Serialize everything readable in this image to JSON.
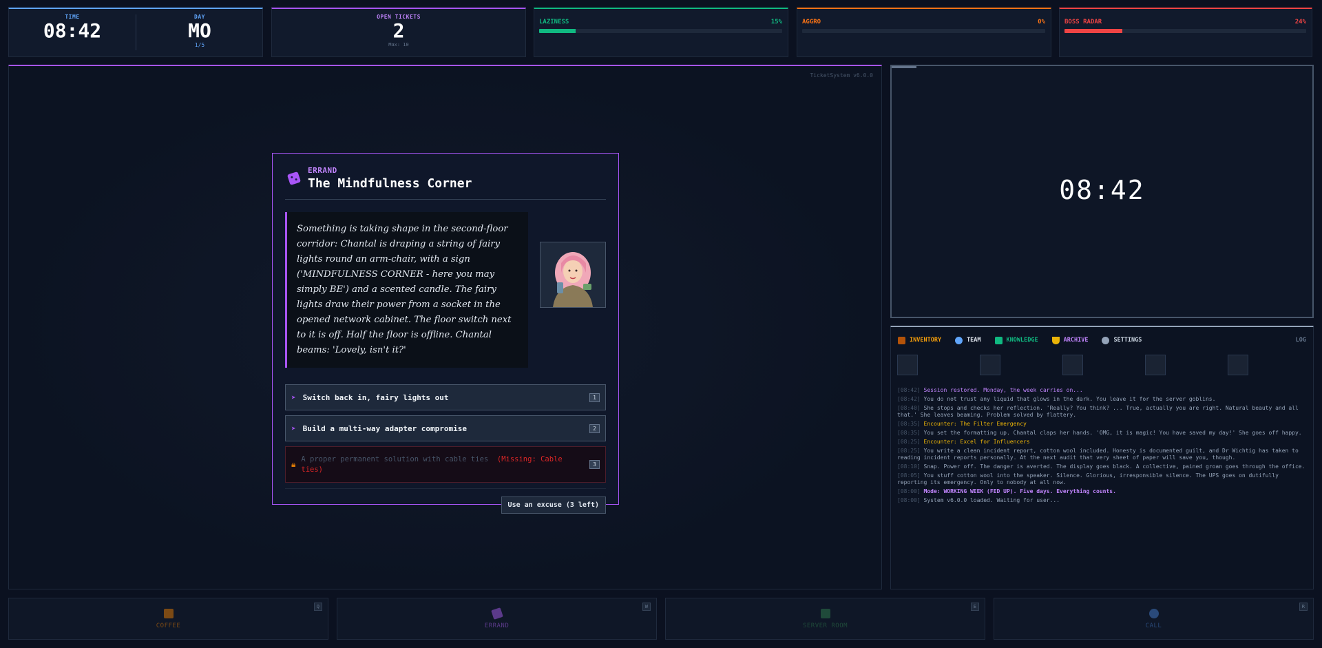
{
  "stats": {
    "time_label": "TIME",
    "time_value": "08:42",
    "day_label": "DAY",
    "day_value": "MO",
    "day_progress": "1/5",
    "tickets_label": "OPEN TICKETS",
    "tickets_value": "2",
    "tickets_max": "Max: 10",
    "laziness": {
      "label": "LAZINESS",
      "value": "15%",
      "percent": 15,
      "color": "#10b981"
    },
    "aggro": {
      "label": "AGGRO",
      "value": "0%",
      "percent": 0,
      "color": "#f97316"
    },
    "boss": {
      "label": "BOSS RADAR",
      "value": "24%",
      "percent": 24,
      "color": "#ef4444"
    }
  },
  "main": {
    "version": "TicketSystem v6.0.0",
    "card": {
      "category": "ERRAND",
      "title": "The Mindfulness Corner",
      "story": "Something is taking shape in the second-floor corridor: Chantal is draping a string of fairy lights round an arm-chair, with a sign ('MINDFULNESS CORNER - here you may simply BE') and a scented candle. The fairy lights draw their power from a socket in the opened network cabinet. The floor switch next to it is off. Half the floor is offline. Chantal beams: 'Lovely, isn't it?'",
      "options": [
        {
          "label": "Switch back in, fairy lights out",
          "key": "1"
        },
        {
          "label": "Build a multi-way adapter compromise",
          "key": "2"
        }
      ],
      "locked_option": {
        "label": "A proper permanent solution with cable ties",
        "missing": "(Missing: Cable ties)",
        "key": "3"
      },
      "excuse_button": "Use an excuse (3 left)"
    }
  },
  "monitor": {
    "time": "08:42"
  },
  "side": {
    "tabs": {
      "inventory": "INVENTORY",
      "team": "TEAM",
      "knowledge": "KNOWLEDGE",
      "archive": "ARCHIVE",
      "settings": "SETTINGS",
      "log": "LOG"
    },
    "log": [
      {
        "ts": "[08:42]",
        "text": "Session restored. Monday, the week carries on...",
        "style": "purple"
      },
      {
        "ts": "[08:42]",
        "text": "You do not trust any liquid that glows in the dark. You leave it for the server goblins.",
        "style": ""
      },
      {
        "ts": "[08:40]",
        "text": "She stops and checks her reflection. 'Really? You think? ... True, actually you are right. Natural beauty and all that.' She leaves beaming. Problem solved by flattery.",
        "style": ""
      },
      {
        "ts": "[08:35]",
        "text": "Encounter: The Filter Emergency",
        "style": "yellow"
      },
      {
        "ts": "[08:35]",
        "text": "You set the formatting up. Chantal claps her hands. 'OMG, it is magic! You have saved my day!' She goes off happy.",
        "style": ""
      },
      {
        "ts": "[08:25]",
        "text": "Encounter: Excel for Influencers",
        "style": "yellow"
      },
      {
        "ts": "[08:25]",
        "text": "You write a clean incident report, cotton wool included. Honesty is documented guilt, and Dr Wichtig has taken to reading incident reports personally. At the next audit that very sheet of paper will save you, though.",
        "style": ""
      },
      {
        "ts": "[08:10]",
        "text": "Snap. Power off. The danger is averted. The display goes black. A collective, pained groan goes through the office.",
        "style": ""
      },
      {
        "ts": "[08:05]",
        "text": "You stuff cotton wool into the speaker. Silence. Glorious, irresponsible silence. The UPS goes on dutifully reporting its emergency. Only to nobody at all now.",
        "style": ""
      },
      {
        "ts": "[08:00]",
        "text": "Mode: WORKING WEEK (FED UP). Five days. Everything counts.",
        "style": "purplebold"
      },
      {
        "ts": "[08:00]",
        "text": "System v6.0.0 loaded. Waiting for user...",
        "style": ""
      }
    ]
  },
  "actions": [
    {
      "label": "COFFEE",
      "key": "Q",
      "color": "#7c4a14"
    },
    {
      "label": "ERRAND",
      "key": "W",
      "color": "#5b3a8a"
    },
    {
      "label": "SERVER ROOM",
      "key": "E",
      "color": "#1f4a3a"
    },
    {
      "label": "CALL",
      "key": "R",
      "color": "#2a4a7a"
    }
  ],
  "icons": [
    "die-icon",
    "lock-icon",
    "arrow-icon",
    "inventory-icon",
    "team-icon",
    "knowledge-icon",
    "archive-icon",
    "settings-icon",
    "coffee-icon",
    "errand-icon",
    "server-icon",
    "call-icon"
  ]
}
